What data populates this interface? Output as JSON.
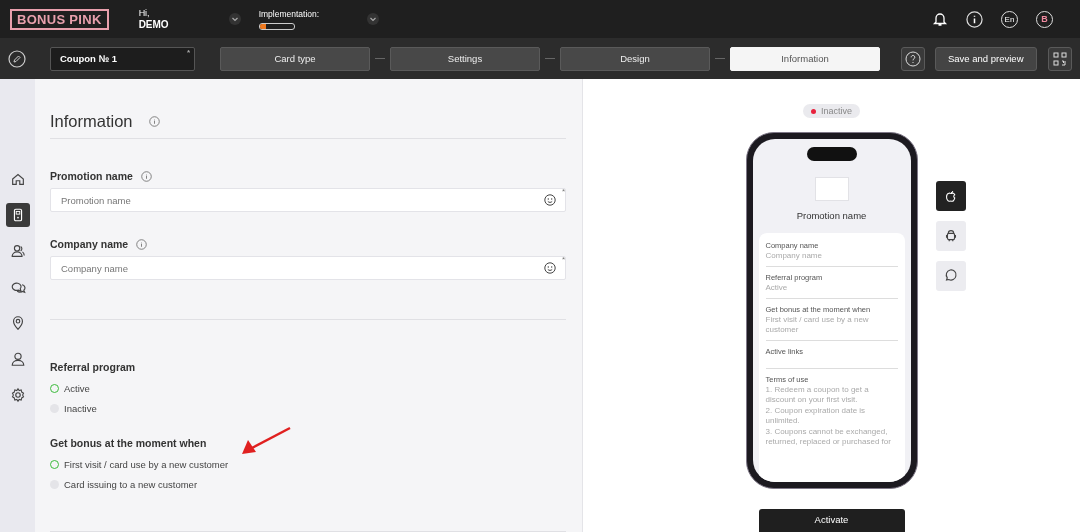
{
  "header": {
    "logo": "BONUS PINK",
    "greeting": "Hi,",
    "user": "DEMO",
    "implementation_label": "Implementation:",
    "implementation": {
      "level": 0.2
    },
    "language": "En",
    "avatar": "B"
  },
  "toolbar": {
    "coupon_name": "Coupon № 1",
    "coupon_required_mark": "*",
    "steps": [
      {
        "label": "Card type",
        "selected": false
      },
      {
        "label": "Settings",
        "selected": false
      },
      {
        "label": "Design",
        "selected": false
      },
      {
        "label": "Information",
        "selected": true
      }
    ],
    "save": "Save and preview"
  },
  "sidebar": {
    "items": [
      {
        "kind": "home",
        "selected": false
      },
      {
        "kind": "card",
        "selected": true
      },
      {
        "kind": "clients",
        "selected": false
      },
      {
        "kind": "chat",
        "selected": false
      },
      {
        "kind": "location",
        "selected": false
      },
      {
        "kind": "user",
        "selected": false
      },
      {
        "kind": "settings",
        "selected": false
      }
    ]
  },
  "form": {
    "title": "Information",
    "fields": [
      {
        "label": "Promotion name",
        "placeholder": "Promotion name",
        "required_mark": "*"
      },
      {
        "label": "Company name",
        "placeholder": "Company name",
        "required_mark": "*"
      }
    ],
    "groups": [
      {
        "title": "Referral program",
        "options": [
          {
            "label": "Active",
            "selected": true
          },
          {
            "label": "Inactive",
            "selected": false
          }
        ]
      },
      {
        "title": "Get bonus at the moment when",
        "options": [
          {
            "label": "First visit / card use by a new customer",
            "selected": true
          },
          {
            "label": "Card issuing to a new customer",
            "selected": false
          }
        ]
      }
    ]
  },
  "preview": {
    "status": {
      "label": "Inactive",
      "color": "#e8213c"
    },
    "platforms": [
      {
        "kind": "apple",
        "selected": true
      },
      {
        "kind": "android",
        "selected": false
      },
      {
        "kind": "message",
        "selected": false
      }
    ],
    "phone": {
      "promotion_name": "Promotion name",
      "rows": [
        {
          "label": "Company name",
          "value": "Company name"
        },
        {
          "label": "Referral program",
          "value": "Active"
        },
        {
          "label": "Get bonus at the moment when",
          "value": "First visit / card use by a new customer"
        },
        {
          "label": "Active links"
        },
        {
          "label": "Terms of use",
          "lines": [
            "1. Redeem a coupon to get a discount on your first visit.",
            "2. Coupon expiration date is unlimited.",
            "3. Coupons cannot be exchanged, returned, replaced or purchased for"
          ]
        }
      ]
    },
    "activate": "Activate"
  }
}
